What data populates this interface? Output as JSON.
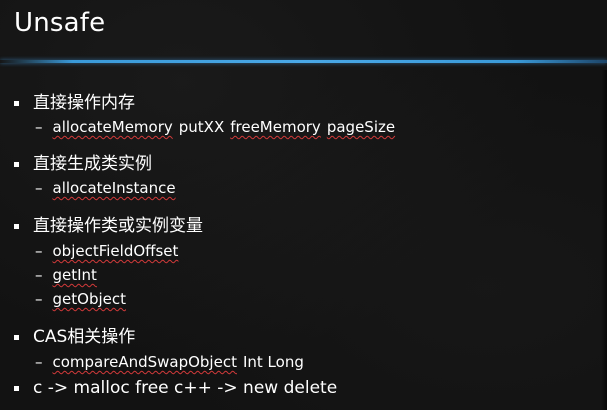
{
  "slide": {
    "title": "Unsafe",
    "accent_color": "#3a9ad9",
    "spell_underline_color": "#d23a3a",
    "sections": [
      {
        "heading": "直接操作内存",
        "items": [
          {
            "parts": [
              "allocateMemory",
              "putXX",
              "freeMemory",
              "pageSize"
            ]
          }
        ]
      },
      {
        "heading": "直接生成类实例",
        "items": [
          {
            "parts": [
              "allocateInstance"
            ]
          }
        ]
      },
      {
        "heading": "直接操作类或实例变量",
        "items": [
          {
            "parts": [
              "objectFieldOffset"
            ]
          },
          {
            "parts": [
              "getInt"
            ]
          },
          {
            "parts": [
              "getObject"
            ]
          }
        ]
      },
      {
        "heading": "CAS相关操作",
        "items": [
          {
            "parts": [
              "compareAndSwapObject",
              "Int Long"
            ]
          }
        ]
      },
      {
        "heading": "c -> malloc free c++ -> new delete",
        "items": []
      }
    ]
  }
}
